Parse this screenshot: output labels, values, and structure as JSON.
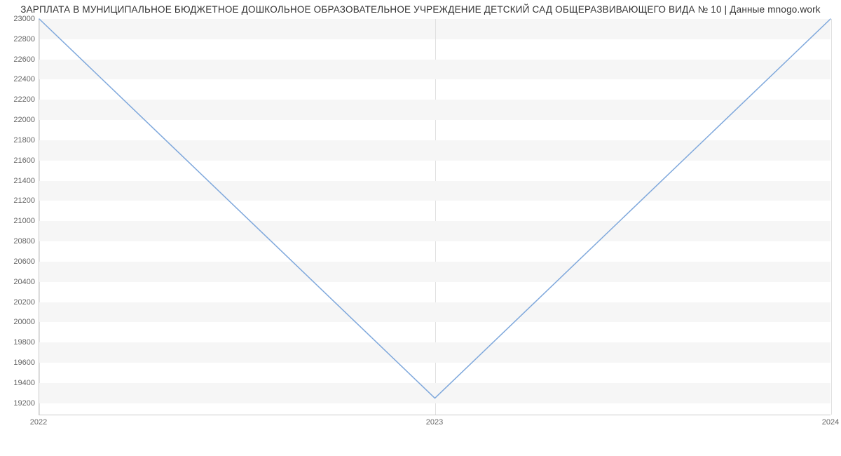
{
  "chart_data": {
    "type": "line",
    "title": "ЗАРПЛАТА В МУНИЦИПАЛЬНОЕ БЮДЖЕТНОЕ ДОШКОЛЬНОЕ ОБРАЗОВАТЕЛЬНОЕ УЧРЕЖДЕНИЕ ДЕТСКИЙ САД ОБЩЕРАЗВИВАЮЩЕГО ВИДА № 10 | Данные mnogo.work",
    "xlabel": "",
    "ylabel": "",
    "x": [
      2022,
      2023,
      2024
    ],
    "values": [
      23000,
      19243,
      23000
    ],
    "x_ticks": [
      2022,
      2023,
      2024
    ],
    "y_ticks": [
      19200,
      19400,
      19600,
      19800,
      20000,
      20200,
      20400,
      20600,
      20800,
      21000,
      21200,
      21400,
      21600,
      21800,
      22000,
      22200,
      22400,
      22600,
      22800,
      23000
    ],
    "xlim": [
      2022,
      2024
    ],
    "ylim": [
      19080,
      23000
    ],
    "grid": true,
    "line_color": "#7fa8dc"
  }
}
